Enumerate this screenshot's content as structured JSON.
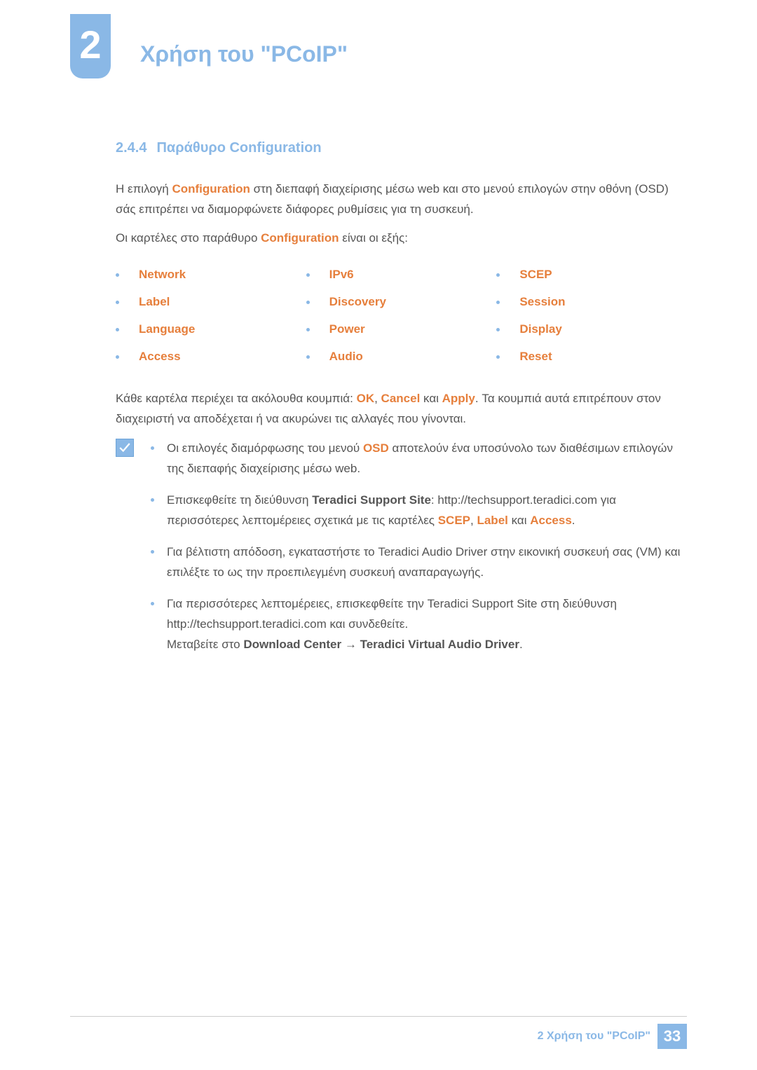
{
  "header": {
    "chapter_number": "2",
    "chapter_title": "Χρήση του \"PCoIP\""
  },
  "section": {
    "number": "2.4.4",
    "title": "Παράθυρο Configuration"
  },
  "intro": {
    "p1_a": "Η επιλογή ",
    "p1_hl": "Configuration",
    "p1_b": " στη διεπαφή διαχείρισης μέσω web και στο μενού επιλογών στην οθόνη (OSD) σάς επιτρέπει να διαμορφώνετε διάφορες ρυθμίσεις για τη συσκευή.",
    "p2_a": "Οι καρτέλες στο παράθυρο ",
    "p2_hl": "Configuration",
    "p2_b": " είναι οι εξής:"
  },
  "tabs": {
    "col1": [
      "Network",
      "Label",
      "Language",
      "Access"
    ],
    "col2": [
      "IPv6",
      "Discovery",
      "Power",
      "Audio"
    ],
    "col3": [
      "SCEP",
      "Session",
      "Display",
      "Reset"
    ]
  },
  "buttons_para": {
    "a": "Κάθε καρτέλα περιέχει τα ακόλουθα κουμπιά: ",
    "ok": "OK",
    "sep1": ", ",
    "cancel": "Cancel",
    "sep2": " και ",
    "apply": "Apply",
    "b": ". Τα κουμπιά αυτά επιτρέπουν στον διαχειριστή να αποδέχεται ή να ακυρώνει τις αλλαγές που γίνονται."
  },
  "notes": [
    {
      "a": "Οι επιλογές διαμόρφωσης του μενού ",
      "hl1": "OSD",
      "b": " αποτελούν ένα υποσύνολο των διαθέσιμων επιλογών της διεπαφής διαχείρισης μέσω web."
    },
    {
      "a": "Επισκεφθείτε τη διεύθυνση ",
      "bold1": "Teradici Support Site",
      "b": ": http://techsupport.teradici.com για περισσότερες λεπτομέρειες σχετικά με τις καρτέλες ",
      "hl1": "SCEP",
      "sep1": ", ",
      "hl2": "Label",
      "sep2": " και ",
      "hl3": "Access",
      "c": "."
    },
    {
      "a": "Για βέλτιστη απόδοση, εγκαταστήστε το Teradici Audio Driver στην εικονική συσκευή σας (VM) και επιλέξτε το ως την προεπιλεγμένη συσκευή αναπαραγωγής."
    },
    {
      "a": "Για περισσότερες λεπτομέρειες, επισκεφθείτε την Teradici Support Site στη διεύθυνση http://techsupport.teradici.com και συνδεθείτε.",
      "line2_a": "Μεταβείτε στο ",
      "bold1": "Download Center",
      "arrow": " → ",
      "bold2": "Teradici Virtual Audio Driver",
      "line2_b": "."
    }
  ],
  "footer": {
    "title": "2 Χρήση του \"PCoIP\"",
    "page": "33"
  }
}
